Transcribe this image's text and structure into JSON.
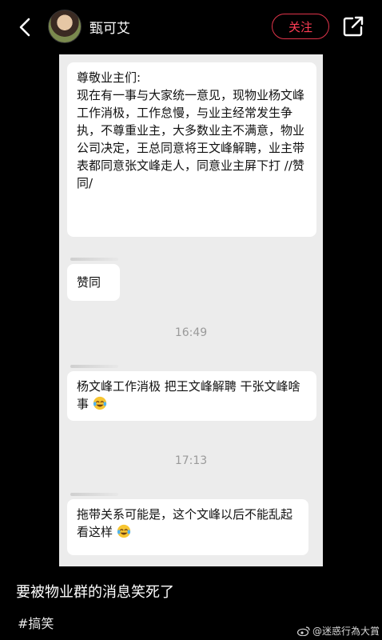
{
  "header": {
    "username": "甄可艾",
    "follow_label": "关注"
  },
  "chat": {
    "message1": {
      "greeting": "尊敬业主们:",
      "body": " 现在有一事与大家统一意见，现物业杨文峰工作消极，工作怠慢，与业主经常发生争执，不尊重业主，大多数业主不满意，物业公司决定，王总同意将王文峰解聘，业主带表都同意张文峰走人，同意业主屏下打 //赞同/"
    },
    "message2": "赞同",
    "time1": "16:49",
    "message3": "杨文峰工作消极 把王文峰解聘 干张文峰啥事",
    "time2": "17:13",
    "message4": "拖带关系可能是，这个文峰以后不能乱起看这样"
  },
  "post": {
    "caption": "要被物业群的消息笑死了",
    "hashtag": "#搞笑"
  },
  "watermark": "@迷惑行為大賞",
  "icons": {
    "back": "chevron-left-icon",
    "share": "share-icon",
    "emoji": "laughing-tears-emoji-icon",
    "weibo": "weibo-logo-icon"
  },
  "colors": {
    "accent": "#e0344a",
    "background": "#000000",
    "chat_bg": "#ececec"
  }
}
